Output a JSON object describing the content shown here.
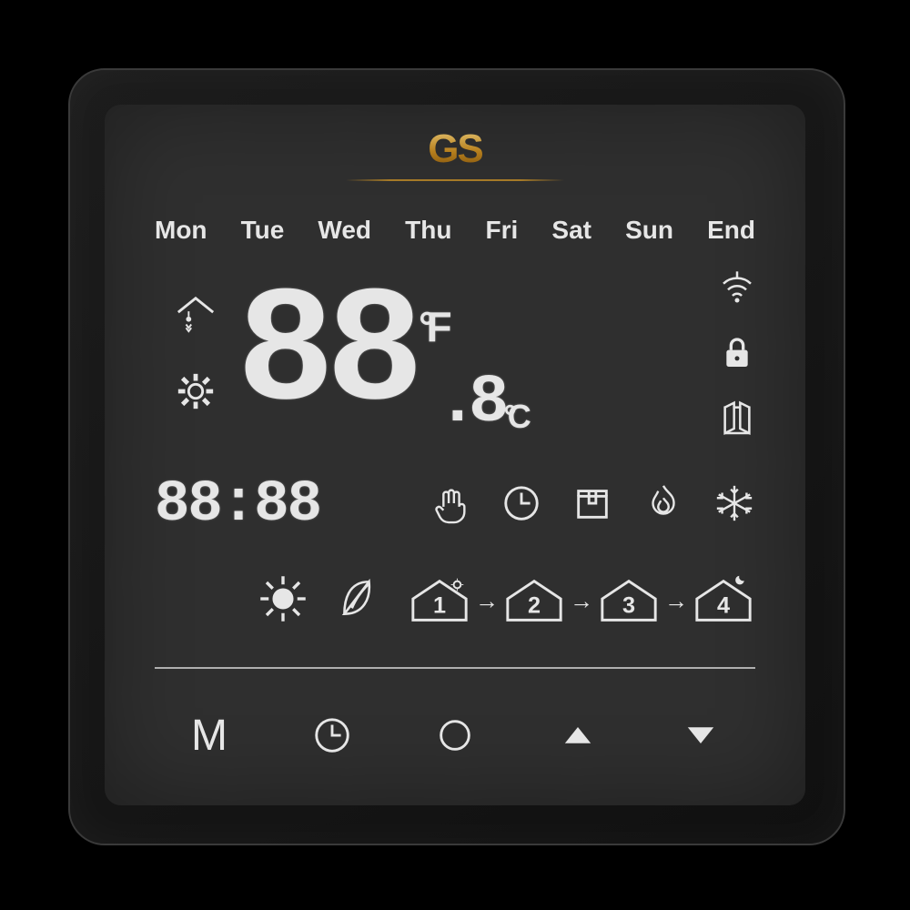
{
  "brand": "GS",
  "days": [
    "Mon",
    "Tue",
    "Wed",
    "Thu",
    "Fri",
    "Sat",
    "Sun",
    "End"
  ],
  "temp": {
    "big": "88",
    "unit_f": "°F",
    "sub": ".8",
    "unit_c": "°C"
  },
  "clock": "88:88",
  "mode_icons": [
    "manual",
    "schedule",
    "away",
    "heat",
    "cool"
  ],
  "periods": [
    "sun",
    "eco",
    "1",
    "2",
    "3",
    "4"
  ],
  "buttons": {
    "mode": "M"
  }
}
